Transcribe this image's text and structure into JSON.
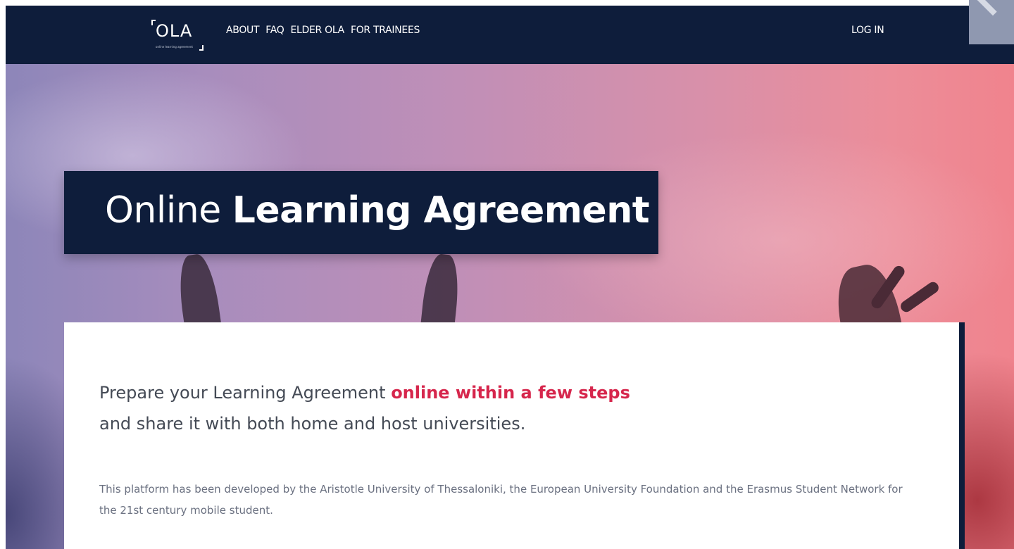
{
  "nav": {
    "logo": {
      "text": "OLA",
      "subtext": "online learning agreement"
    },
    "links": [
      "ABOUT",
      "FAQ",
      "ELDER OLA",
      "FOR TRAINEES"
    ],
    "login": "LOG IN"
  },
  "hero": {
    "title_light": "Online",
    "title_bold": "Learning Agreement"
  },
  "card": {
    "headline_part1": "Prepare your Learning Agreement",
    "headline_accent": "online within a few steps",
    "headline_part2": "and share it with both home and host universities.",
    "description": "This platform has been developed by the Aristotle University of Thessaloniki, the European University Foundation and the Erasmus Student Network for the 21st century mobile student."
  },
  "colors": {
    "navy": "#0e1d3b",
    "accent": "#d6264c",
    "text": "#444a55"
  }
}
